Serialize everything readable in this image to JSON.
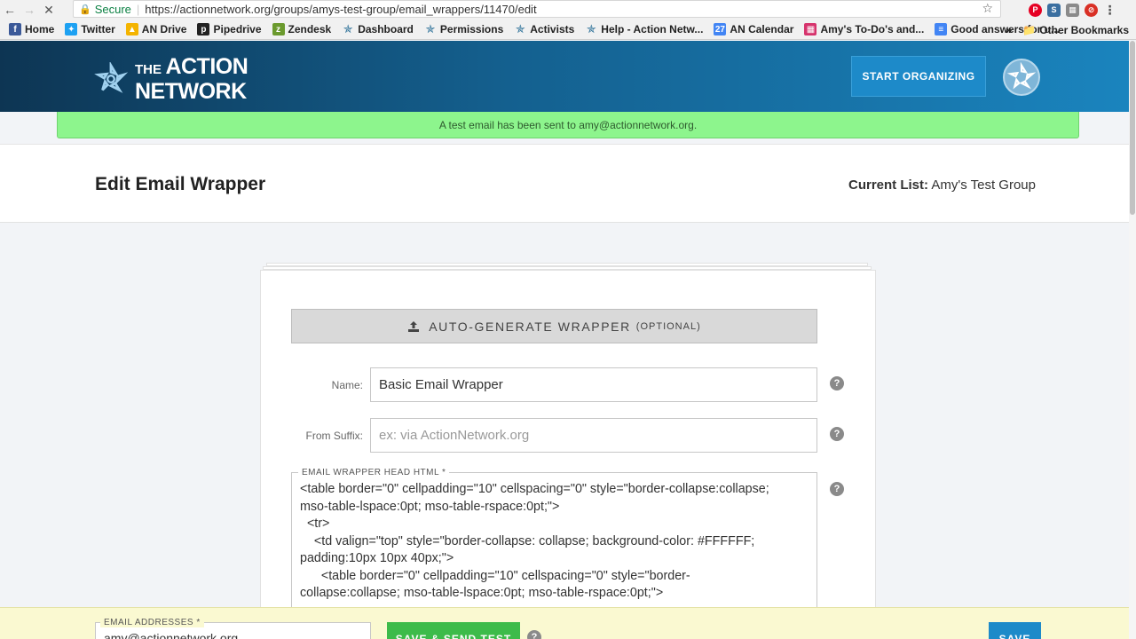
{
  "browser": {
    "secure_label": "Secure",
    "url": "https://actionnetwork.org/groups/amys-test-group/email_wrappers/11470/edit",
    "bookmarks": [
      {
        "label": "Home",
        "icon": "facebook-icon",
        "color": "#3b5998"
      },
      {
        "label": "Twitter",
        "icon": "twitter-icon",
        "color": "#1da1f2"
      },
      {
        "label": "AN Drive",
        "icon": "drive-icon",
        "color": "#f4b400"
      },
      {
        "label": "Pipedrive",
        "icon": "pipedrive-icon",
        "color": "#222222"
      },
      {
        "label": "Zendesk",
        "icon": "zendesk-icon",
        "color": "#6b9a2e"
      },
      {
        "label": "Dashboard",
        "icon": "an-star-icon",
        "color": "#2a6f97"
      },
      {
        "label": "Permissions",
        "icon": "an-star-icon",
        "color": "#2a6f97"
      },
      {
        "label": "Activists",
        "icon": "an-star-icon",
        "color": "#2a6f97"
      },
      {
        "label": "Help - Action Netw...",
        "icon": "an-star-icon",
        "color": "#2a6f97"
      },
      {
        "label": "AN Calendar",
        "icon": "calendar-icon",
        "color": "#4285f4"
      },
      {
        "label": "Amy's To-Do's and...",
        "icon": "trello-icon",
        "color": "#d6336c"
      },
      {
        "label": "Good answers for u...",
        "icon": "docs-icon",
        "color": "#4285f4"
      }
    ],
    "more_label": "»",
    "other_bookmarks": "Other Bookmarks"
  },
  "header": {
    "logo_line1_small": "THE",
    "logo_line1_big": "ACTION",
    "logo_line2": "NETWORK",
    "start_button": "START ORGANIZING"
  },
  "flash": {
    "message": "A test email has been sent to amy@actionnetwork.org."
  },
  "page": {
    "title": "Edit Email Wrapper",
    "current_list_label": "Current List:",
    "current_list_value": "Amy's Test Group"
  },
  "form": {
    "autogen_label": "AUTO-GENERATE WRAPPER",
    "autogen_optional": "(OPTIONAL)",
    "name_label": "Name:",
    "name_value": "Basic Email Wrapper",
    "suffix_label": "From Suffix:",
    "suffix_placeholder": "ex: via ActionNetwork.org",
    "head_html_legend": "EMAIL WRAPPER HEAD HTML *",
    "head_html_value": "<table border=\"0\" cellpadding=\"10\" cellspacing=\"0\" style=\"border-collapse:collapse;\nmso-table-lspace:0pt; mso-table-rspace:0pt;\">\n  <tr>\n    <td valign=\"top\" style=\"border-collapse: collapse; background-color: #FFFFFF;\npadding:10px 10px 40px;\">\n      <table border=\"0\" cellpadding=\"10\" cellspacing=\"0\" style=\"border-\ncollapse:collapse; mso-table-lspace:0pt; mso-table-rspace:0pt;\">",
    "help_glyph": "?"
  },
  "footer": {
    "email_legend": "EMAIL ADDRESSES *",
    "email_value": "amy@actionnetwork.org",
    "send_test_button": "SAVE & SEND TEST",
    "save_button": "SAVE"
  },
  "colors": {
    "flash_green": "#8df58d",
    "brand_blue": "#1d8ac9",
    "send_green": "#3dbb4a"
  }
}
